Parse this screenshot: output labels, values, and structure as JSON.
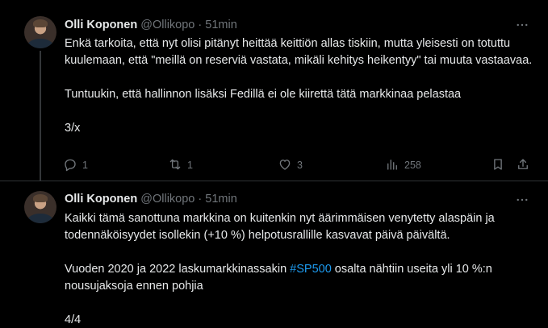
{
  "colors": {
    "background": "#000000",
    "text": "#e7e9ea",
    "muted": "#71767b",
    "link": "#1d9bf0",
    "divider": "#2f3336"
  },
  "tweets": [
    {
      "name": "Olli Koponen",
      "handle": "@Ollikopo",
      "dot": "·",
      "time": "51min",
      "paragraphs": [
        "Enkä tarkoita, että nyt olisi pitänyt heittää keittiön allas tiskiin, mutta yleisesti on totuttu kuulemaan, että \"meillä on reserviä vastata, mikäli kehitys heikentyy\" tai muuta vastaavaa.",
        "Tuntuukin, että hallinnon lisäksi Fedillä ei ole kiirettä tätä markkinaa pelastaa",
        "3/x"
      ],
      "actions": {
        "reply_count": "1",
        "retweet_count": "1",
        "like_count": "3",
        "views_count": "258"
      }
    },
    {
      "name": "Olli Koponen",
      "handle": "@Ollikopo",
      "dot": "·",
      "time": "51min",
      "paragraph1": "Kaikki tämä sanottuna markkina on kuitenkin nyt äärimmäisen venytetty alaspäin ja todennäköisyydet isollekin (+10 %) helpotusrallille kasvavat päivä päivältä.",
      "paragraph2_before": "Vuoden 2020 ja 2022 laskumarkkinassakin ",
      "paragraph2_hashtag": "#SP500",
      "paragraph2_after": " osalta nähtiin useita yli 10 %:n nousujaksoja ennen pohjia",
      "paragraph3": "4/4"
    }
  ],
  "icons": {
    "more": "more-dots-icon",
    "reply": "reply-icon",
    "retweet": "retweet-icon",
    "like": "like-icon",
    "views": "views-icon",
    "bookmark": "bookmark-icon",
    "share": "share-icon"
  }
}
